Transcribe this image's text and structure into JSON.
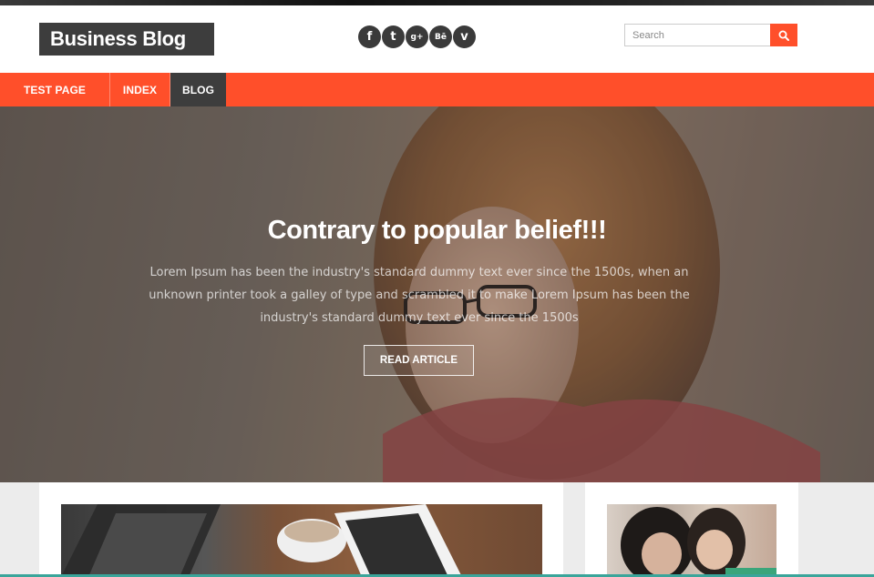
{
  "header": {
    "logo_text": "Business Blog",
    "social": [
      {
        "icon": "facebook-icon",
        "glyph": "f"
      },
      {
        "icon": "twitter-icon",
        "glyph": "t"
      },
      {
        "icon": "google-plus-icon",
        "glyph": "g+"
      },
      {
        "icon": "behance-icon",
        "glyph": "Bē"
      },
      {
        "icon": "vimeo-icon",
        "glyph": "v"
      }
    ],
    "search": {
      "placeholder": "Search"
    }
  },
  "nav": {
    "items": [
      {
        "label": "TEST PAGE"
      },
      {
        "label": "INDEX"
      },
      {
        "label": "BLOG",
        "active": true
      }
    ]
  },
  "hero": {
    "title": "Contrary to popular belief!!!",
    "text": "Lorem Ipsum has been the industry's standard dummy text ever since the 1500s, when an unknown printer took a galley of type and scrambled it to make Lorem Ipsum has been the industry's standard dummy text ever since the 1500s",
    "button_label": "READ ARTICLE"
  },
  "colors": {
    "accent": "#ff4f2a",
    "dark": "#3d3d3d",
    "bottom_bar": "#3aa59a"
  }
}
